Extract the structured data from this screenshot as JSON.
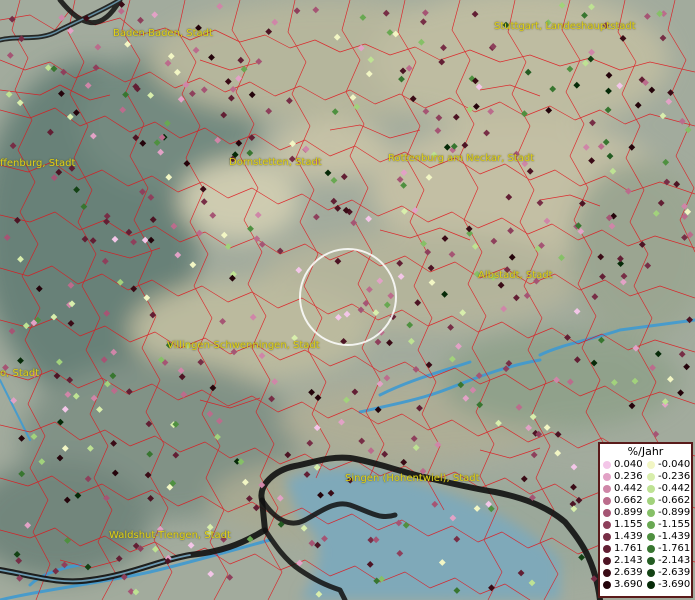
{
  "cities": [
    {
      "id": "baden-baden",
      "label": "Baden-Baden, Stadt"
    },
    {
      "id": "stuttgart",
      "label": "Stuttgart, Landeshauptstadt"
    },
    {
      "id": "offenburg",
      "label": "ffenburg, Stadt"
    },
    {
      "id": "dornstetten",
      "label": "Dornstetten, Stadt"
    },
    {
      "id": "rottenburg",
      "label": "Rottenburg am Neckar, Stadt"
    },
    {
      "id": "albstadt",
      "label": "Albstadt, Stadt"
    },
    {
      "id": "villingen",
      "label": "Villingen-Schwenningen, Stadt"
    },
    {
      "id": "lahr",
      "label": "o, Stadt"
    },
    {
      "id": "singen",
      "label": "Singen (Hohentwiel), Stadt"
    },
    {
      "id": "waldshut",
      "label": "Waldshut-Tiengen, Stadt"
    }
  ],
  "legend": {
    "title": "%/Jahr",
    "positive": [
      {
        "value": "0.040",
        "color": "#f3c6e8"
      },
      {
        "value": "0.236",
        "color": "#e2a2c6"
      },
      {
        "value": "0.442",
        "color": "#cf86a8"
      },
      {
        "value": "0.662",
        "color": "#bb6c8c"
      },
      {
        "value": "0.899",
        "color": "#a55574"
      },
      {
        "value": "1.155",
        "color": "#8e405c"
      },
      {
        "value": "1.439",
        "color": "#772e46"
      },
      {
        "value": "1.761",
        "color": "#621f34"
      },
      {
        "value": "2.143",
        "color": "#4d1424"
      },
      {
        "value": "2.639",
        "color": "#3a0b16"
      },
      {
        "value": "3.690",
        "color": "#24040b"
      }
    ],
    "negative": [
      {
        "value": "-0.040",
        "color": "#f2f6c4"
      },
      {
        "value": "-0.236",
        "color": "#d8eeac"
      },
      {
        "value": "-0.442",
        "color": "#bee293"
      },
      {
        "value": "-0.662",
        "color": "#a2d27c"
      },
      {
        "value": "-0.899",
        "color": "#86c067"
      },
      {
        "value": "-1.155",
        "color": "#69a852"
      },
      {
        "value": "-1.439",
        "color": "#4f9040"
      },
      {
        "value": "-1.761",
        "color": "#387630"
      },
      {
        "value": "-2.143",
        "color": "#245c22"
      },
      {
        "value": "-2.639",
        "color": "#134214"
      },
      {
        "value": "-3.690",
        "color": "#062a08"
      }
    ]
  }
}
